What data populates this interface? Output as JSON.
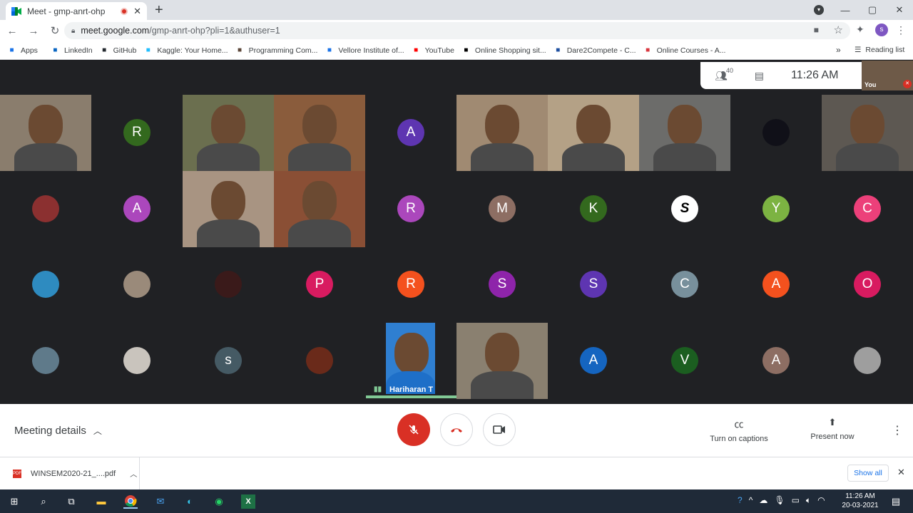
{
  "tab": {
    "title": "Meet - gmp-anrt-ohp",
    "close": "✕"
  },
  "new_tab": "+",
  "window_controls": {
    "minimize": "—",
    "maximize": "▢",
    "close": "✕"
  },
  "address": {
    "host": "meet.google.com",
    "path": "/gmp-anrt-ohp?pli=1&authuser=1"
  },
  "profile_initial": "s",
  "bookmarks": [
    {
      "label": "Apps",
      "icon": "apps-grid-icon",
      "color": "#1a73e8"
    },
    {
      "label": "LinkedIn",
      "icon": "linkedin-icon",
      "color": "#0a66c2"
    },
    {
      "label": "GitHub",
      "icon": "github-icon",
      "color": "#24292f"
    },
    {
      "label": "Kaggle: Your Home...",
      "icon": "kaggle-icon",
      "color": "#20beff"
    },
    {
      "label": "Programming Com...",
      "icon": "codechef-icon",
      "color": "#5b4638"
    },
    {
      "label": "Vellore Institute of...",
      "icon": "link-icon",
      "color": "#1a73e8"
    },
    {
      "label": "YouTube",
      "icon": "youtube-icon",
      "color": "#ff0000"
    },
    {
      "label": "Online Shopping sit...",
      "icon": "amazon-icon",
      "color": "#000000"
    },
    {
      "label": "Dare2Compete - C...",
      "icon": "dare2compete-icon",
      "color": "#1e4fa0"
    },
    {
      "label": "Online Courses - A...",
      "icon": "coursera-icon",
      "color": "#d9363e"
    }
  ],
  "bookmarks_more": "»",
  "reading_list": "Reading list",
  "meet": {
    "participant_count": "40",
    "time": "11:26 AM",
    "self_label": "You",
    "speaker_name": "Hariharan T",
    "meeting_details": "Meeting details",
    "captions": "Turn on captions",
    "present": "Present now"
  },
  "tiles": [
    {
      "kind": "video",
      "bg": "#8a7d6d"
    },
    {
      "kind": "avatar",
      "letter": "R",
      "color": "#33691e"
    },
    {
      "kind": "video",
      "bg": "#6b6f4f"
    },
    {
      "kind": "video",
      "bg": "#8a5c3c"
    },
    {
      "kind": "avatar",
      "letter": "A",
      "color": "#5e35b1"
    },
    {
      "kind": "video",
      "bg": "#a08a72"
    },
    {
      "kind": "video",
      "bg": "#b4a186"
    },
    {
      "kind": "video",
      "bg": "#6c6c6a"
    },
    {
      "kind": "avatar",
      "letter": "",
      "color": "#101018"
    },
    {
      "kind": "video",
      "bg": "#5d5852"
    },
    {
      "kind": "avatar",
      "letter": "",
      "color": "#8b3030"
    },
    {
      "kind": "avatar",
      "letter": "A",
      "color": "#ab47bc"
    },
    {
      "kind": "video",
      "bg": "#a89482"
    },
    {
      "kind": "video",
      "bg": "#8a4f35"
    },
    {
      "kind": "avatar",
      "letter": "R",
      "color": "#ab47bc"
    },
    {
      "kind": "avatar",
      "letter": "M",
      "color": "#8d6e63"
    },
    {
      "kind": "avatar",
      "letter": "K",
      "color": "#33691e"
    },
    {
      "kind": "avatar",
      "letter": "S",
      "color": "#ffffff",
      "text": "#000000"
    },
    {
      "kind": "avatar",
      "letter": "Y",
      "color": "#7cb342"
    },
    {
      "kind": "avatar",
      "letter": "C",
      "color": "#ec407a"
    },
    {
      "kind": "avatar",
      "letter": "",
      "color": "#2e8bc0"
    },
    {
      "kind": "avatar",
      "letter": "",
      "color": "#9a8a7a"
    },
    {
      "kind": "avatar",
      "letter": "",
      "color": "#3a1a1a"
    },
    {
      "kind": "avatar",
      "letter": "P",
      "color": "#d81b60"
    },
    {
      "kind": "avatar",
      "letter": "R",
      "color": "#f4511e"
    },
    {
      "kind": "avatar",
      "letter": "S",
      "color": "#8e24aa"
    },
    {
      "kind": "avatar",
      "letter": "S",
      "color": "#5e35b1"
    },
    {
      "kind": "avatar",
      "letter": "C",
      "color": "#78909c"
    },
    {
      "kind": "avatar",
      "letter": "A",
      "color": "#f4511e"
    },
    {
      "kind": "avatar",
      "letter": "O",
      "color": "#d81b60"
    },
    {
      "kind": "avatar",
      "letter": "",
      "color": "#5f7a8a"
    },
    {
      "kind": "avatar",
      "letter": "",
      "color": "#c9c4bd"
    },
    {
      "kind": "avatar",
      "letter": "s",
      "color": "#455a64"
    },
    {
      "kind": "avatar",
      "letter": "",
      "color": "#6a2a1a"
    },
    {
      "kind": "video",
      "bg": "#2f7fd1"
    },
    {
      "kind": "video",
      "bg": "#8a8070"
    },
    {
      "kind": "avatar",
      "letter": "A",
      "color": "#1565c0"
    },
    {
      "kind": "avatar",
      "letter": "V",
      "color": "#1b5e20"
    },
    {
      "kind": "avatar",
      "letter": "A",
      "color": "#8d6e63"
    },
    {
      "kind": "avatar",
      "letter": "",
      "color": "#9e9e9e"
    }
  ],
  "download": {
    "file": "WINSEM2020-21_....pdf",
    "show_all": "Show all"
  },
  "clock": {
    "time": "11:26 AM",
    "date": "20-03-2021"
  }
}
